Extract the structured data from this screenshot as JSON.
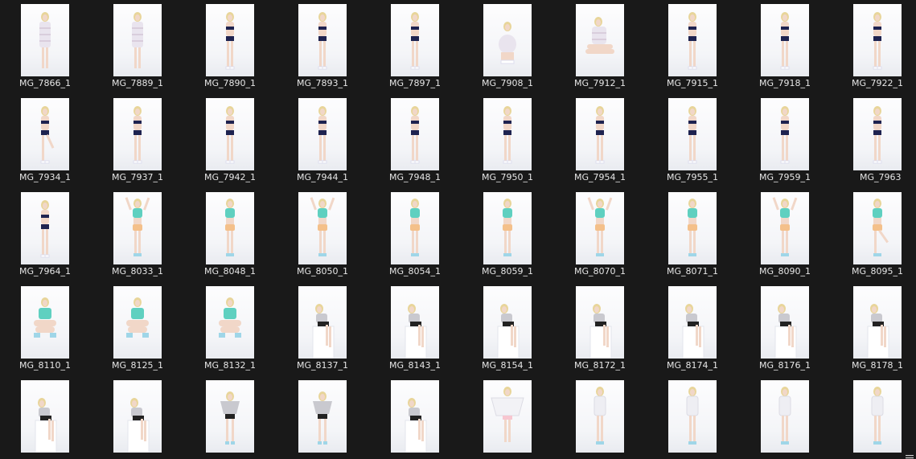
{
  "window": {
    "view_mode": "large-icons",
    "background": "#191919",
    "text_color": "#e6e6e6"
  },
  "files": [
    {
      "name": "MG_7866_1",
      "pose": "standing-dress"
    },
    {
      "name": "MG_7889_1",
      "pose": "standing-dress"
    },
    {
      "name": "MG_7890_1",
      "pose": "standing-swim"
    },
    {
      "name": "MG_7893_1",
      "pose": "standing-swim"
    },
    {
      "name": "MG_7897_1",
      "pose": "standing-side"
    },
    {
      "name": "MG_7908_1",
      "pose": "crouching"
    },
    {
      "name": "MG_7912_1",
      "pose": "sitting-dress"
    },
    {
      "name": "MG_7915_1",
      "pose": "standing-swim"
    },
    {
      "name": "MG_7918_1",
      "pose": "standing-swim"
    },
    {
      "name": "MG_7922_1",
      "pose": "standing-swim"
    },
    {
      "name": "MG_7934_1",
      "pose": "standing-leg-up"
    },
    {
      "name": "MG_7937_1",
      "pose": "standing-side"
    },
    {
      "name": "MG_7942_1",
      "pose": "standing-side"
    },
    {
      "name": "MG_7944_1",
      "pose": "standing-back"
    },
    {
      "name": "MG_7948_1",
      "pose": "standing-side"
    },
    {
      "name": "MG_7950_1",
      "pose": "standing-swim"
    },
    {
      "name": "MG_7954_1",
      "pose": "standing-swim"
    },
    {
      "name": "MG_7955_1",
      "pose": "standing-swim"
    },
    {
      "name": "MG_7959_1",
      "pose": "standing-swim"
    },
    {
      "name": "MG_7963",
      "pose": "standing-swim"
    },
    {
      "name": "MG_7964_1",
      "pose": "standing-swim"
    },
    {
      "name": "MG_8033_1",
      "pose": "arms-up-teal"
    },
    {
      "name": "MG_8048_1",
      "pose": "standing-teal"
    },
    {
      "name": "MG_8050_1",
      "pose": "arm-up-teal"
    },
    {
      "name": "MG_8054_1",
      "pose": "standing-teal"
    },
    {
      "name": "MG_8059_1",
      "pose": "standing-teal"
    },
    {
      "name": "MG_8070_1",
      "pose": "arms-up-teal"
    },
    {
      "name": "MG_8071_1",
      "pose": "standing-teal"
    },
    {
      "name": "MG_8090_1",
      "pose": "arms-up-teal"
    },
    {
      "name": "MG_8095_1",
      "pose": "leg-up-teal"
    },
    {
      "name": "MG_8110_1",
      "pose": "sitting-teal"
    },
    {
      "name": "MG_8125_1",
      "pose": "sitting-teal"
    },
    {
      "name": "MG_8132_1",
      "pose": "sitting-teal"
    },
    {
      "name": "MG_8137_1",
      "pose": "lying-box"
    },
    {
      "name": "MG_8143_1",
      "pose": "sitting-box"
    },
    {
      "name": "MG_8154_1",
      "pose": "sitting-box"
    },
    {
      "name": "MG_8172_1",
      "pose": "sitting-box"
    },
    {
      "name": "MG_8174_1",
      "pose": "sitting-box"
    },
    {
      "name": "MG_8176_1",
      "pose": "sitting-box"
    },
    {
      "name": "MG_8178_1",
      "pose": "sitting-box"
    },
    {
      "name": "",
      "pose": "leaning-box"
    },
    {
      "name": "",
      "pose": "sitting-box"
    },
    {
      "name": "",
      "pose": "bending-skirt"
    },
    {
      "name": "",
      "pose": "bending-skirt"
    },
    {
      "name": "",
      "pose": "sitting-box"
    },
    {
      "name": "",
      "pose": "arms-out-sweater"
    },
    {
      "name": "",
      "pose": "standing-sweater"
    },
    {
      "name": "",
      "pose": "standing-sweater"
    },
    {
      "name": "",
      "pose": "standing-sweater"
    },
    {
      "name": "",
      "pose": "standing-sweater"
    }
  ],
  "status": {
    "corner_icon": "view-toggle-icon"
  }
}
